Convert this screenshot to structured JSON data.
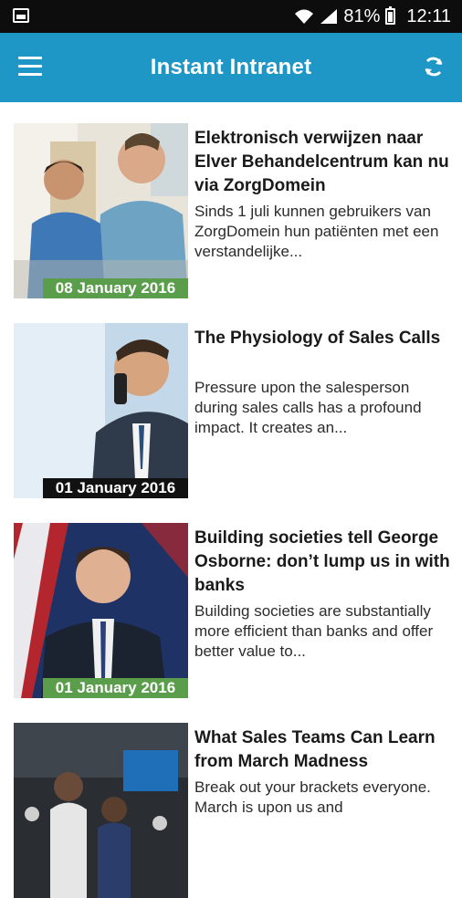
{
  "status_bar": {
    "battery_text": "81%",
    "time": "12:11",
    "icons": [
      "notification-image-icon",
      "wifi-icon",
      "signal-icon",
      "battery-icon"
    ]
  },
  "app_bar": {
    "title": "Instant Intranet",
    "menu_icon": "hamburger-menu-icon",
    "refresh_icon": "refresh-icon",
    "color": "#1f97c6"
  },
  "articles": [
    {
      "title": "Elektronisch verwijzen naar Elver Behandelcentrum kan nu via ZorgDomein",
      "summary": "Sinds 1 juli kunnen gebruikers van ZorgDomein hun patiënten met een verstandelijke...",
      "date": "08 January 2016",
      "badge_color": "#5a9e4c"
    },
    {
      "title": "The Physiology of Sales Calls",
      "summary": "Pressure upon the salesperson during sales calls has a profound impact. It creates an...",
      "date": "01 January 2016",
      "badge_color": "#111111"
    },
    {
      "title": "Building societies tell George Osborne: don’t lump us in with banks",
      "summary": "Building societies are substantially more efficient than banks and offer better value to...",
      "date": "01 January 2016",
      "badge_color": "#5a9e4c"
    },
    {
      "title": "What Sales Teams Can Learn from March Madness",
      "summary": "Break out your brackets everyone. March is upon us and",
      "date": "",
      "badge_color": ""
    }
  ]
}
